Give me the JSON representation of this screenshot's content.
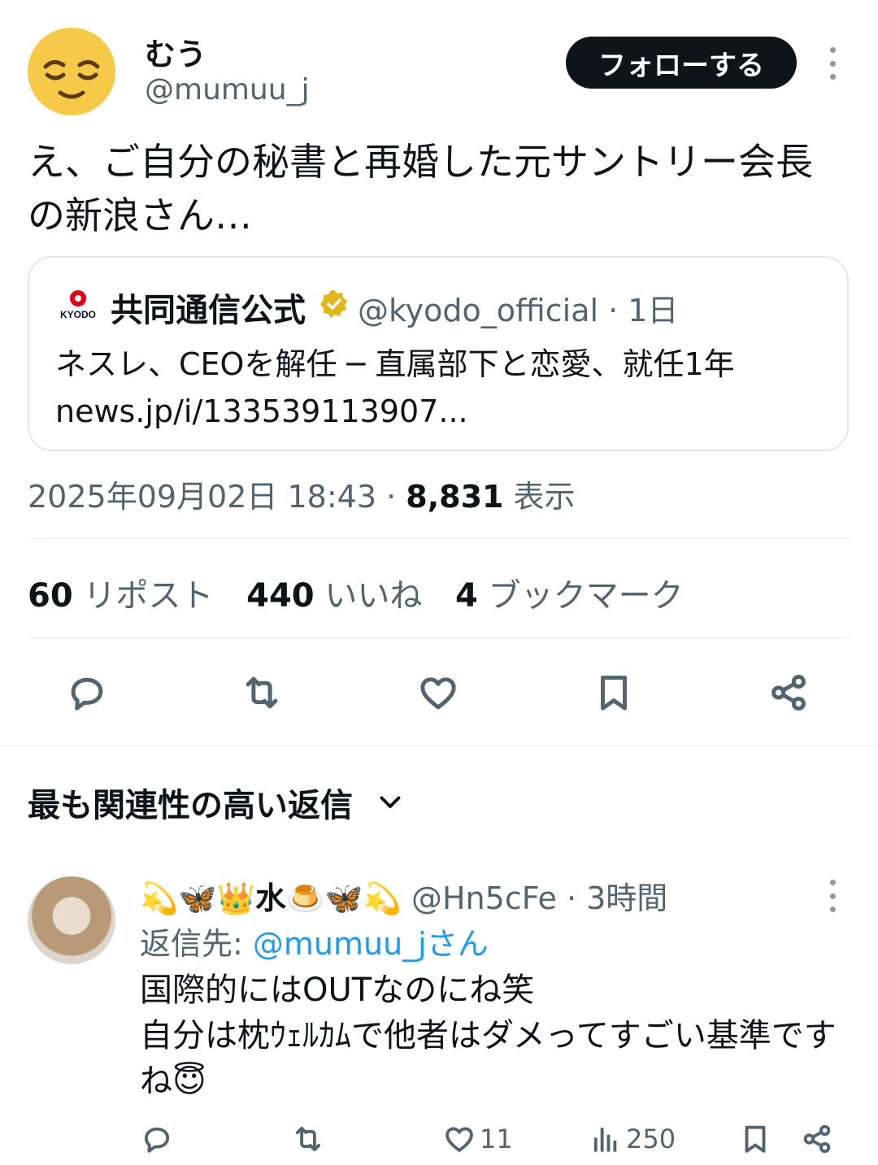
{
  "author": {
    "avatar_icon": "relieved-face-icon",
    "name": "むう",
    "handle": "@mumuu_j",
    "follow_label": "フォローする"
  },
  "tweet": {
    "text": "え、ご自分の秘書と再婚した元サントリー会長の新浪さん…"
  },
  "quote": {
    "logo_text": "KYODO",
    "name": "共同通信公式",
    "verified_icon": "gold-verified-badge-icon",
    "handle_time": "@kyodo_official · 1日",
    "text_line1": "ネスレ、CEOを解任 ─ 直属部下と恋愛、就任1年",
    "text_line2": "news.jp/i/133539113907..."
  },
  "meta": {
    "datetime": "2025年09月02日 18:43 · ",
    "views_count": "8,831",
    "views_label": "表示"
  },
  "stats": {
    "reposts_count": "60",
    "reposts_label": "リポスト",
    "likes_count": "440",
    "likes_label": "いいね",
    "bookmarks_count": "4",
    "bookmarks_label": "ブックマーク"
  },
  "actions": [
    "reply-icon",
    "repost-icon",
    "like-icon",
    "bookmark-icon",
    "share-icon"
  ],
  "replies_sort": {
    "label": "最も関連性の高い返信"
  },
  "reply": {
    "name": "💫🦋👑水🍮🦋💫",
    "handle_time": "@Hn5cFe · 3時間",
    "replying_to_prefix": "返信先: ",
    "replying_to_handle": "@mumuu_jさん",
    "text_line1": "国際的にはOUTなのにね笑",
    "text_line2": "自分は枕ｳｪﾙｶﾑで他者はダメってすごい基準ですね😇",
    "likes": "11",
    "views": "250"
  },
  "colors": {
    "accent": "#1d9bf0",
    "muted": "#536471",
    "button": "#0f1419"
  }
}
